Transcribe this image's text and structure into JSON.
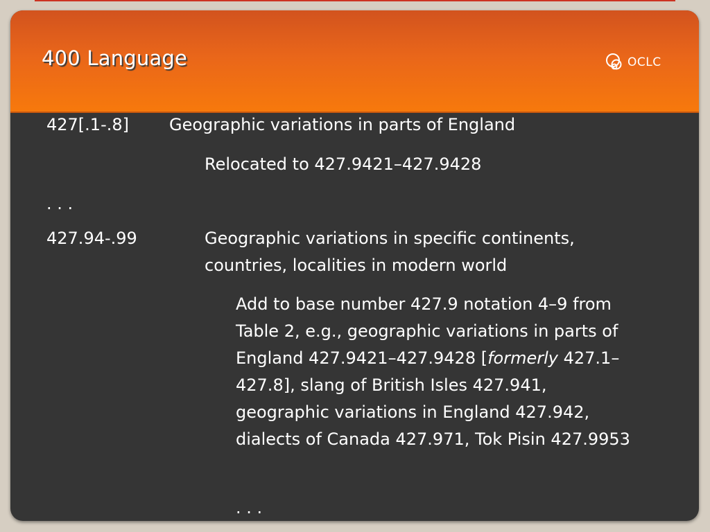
{
  "slide": {
    "title": "400 Language",
    "logo": {
      "icon": "oclc-logo-icon",
      "text": "OCLC"
    }
  },
  "entries": {
    "entry1": {
      "number": "427[.1-.8]",
      "heading": "Geographic variations in parts of England",
      "note": "Relocated to 427.9421–427.9428"
    },
    "ellipsis1": ". . .",
    "entry2": {
      "number": "427.94-.99",
      "heading_line1": "Geographic variations in specific continents,",
      "heading_line2": "countries, localities in modern world",
      "note_part1": "Add to base number 427.9 notation 4–9 from Table 2, e.g., geographic variations in parts of England 427.9421–427.9428 [",
      "note_italic": "formerly",
      "note_part2": " 427.1–427.8], slang of British Isles 427.941, geographic variations in England 427.942, dialects of Canada 427.971, Tok Pisin 427.9953"
    },
    "ellipsis2": ". . ."
  },
  "colors": {
    "header_top": "#d2531e",
    "header_bottom": "#f7790c",
    "body_background": "#353535",
    "text": "#ffffff"
  }
}
